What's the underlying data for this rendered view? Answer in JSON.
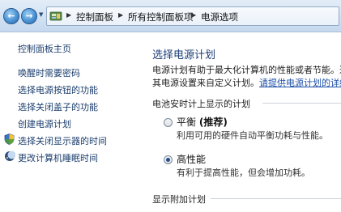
{
  "address_bar": {
    "breadcrumbs": [
      "控制面板",
      "所有控制面板项",
      "电源选项"
    ]
  },
  "left_nav": {
    "home": "控制面板主页",
    "items": [
      "唤醒时需要密码",
      "选择电源按钮的功能",
      "选择关闭盖子的功能",
      "创建电源计划",
      "选择关闭显示器的时间",
      "更改计算机睡眠时间"
    ]
  },
  "main": {
    "title": "选择电源计划",
    "desc_line1": "电源计划有助于最大化计算机的性能或者节能。通过",
    "desc_line2_prefix": "其电源设置来自定义计划。",
    "desc_link": "请提供电源计划的详细信",
    "battery_section": "电池安时计上显示的计划",
    "plans": [
      {
        "name": "平衡",
        "tag": "(推荐)",
        "desc": "利用可用的硬件自动平衡功耗与性能。",
        "selected": false
      },
      {
        "name": "高性能",
        "tag": "",
        "desc": "有利于提高性能，但会增加功耗。",
        "selected": true
      }
    ],
    "more_section": "显示附加计划"
  },
  "colors": {
    "link": "#1c3f6e",
    "title": "#1b3d77",
    "address_bar": "#d2e2f3"
  }
}
